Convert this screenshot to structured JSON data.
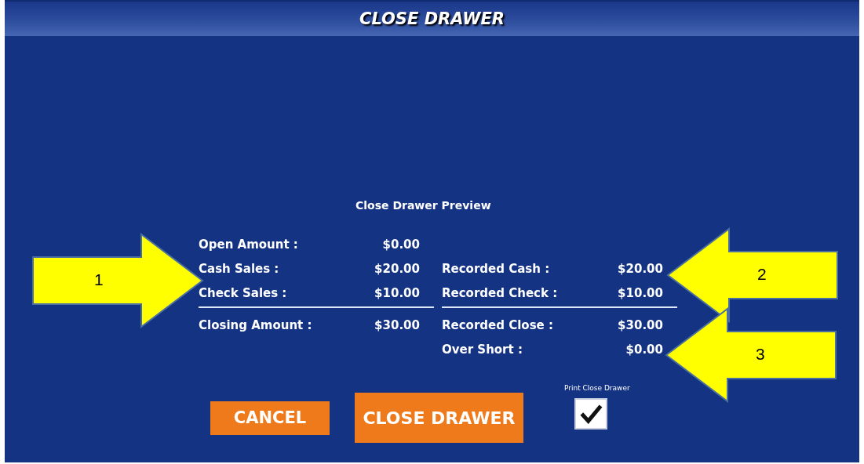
{
  "window": {
    "title": "CLOSE DRAWER"
  },
  "preview": {
    "title": "Close Drawer Preview",
    "left": {
      "rows": [
        {
          "label": "Open Amount :",
          "value": "$0.00"
        },
        {
          "label": "Cash Sales :",
          "value": "$20.00"
        },
        {
          "label": "Check Sales :",
          "value": "$10.00"
        }
      ],
      "totals": [
        {
          "label": "Closing Amount :",
          "value": "$30.00"
        }
      ]
    },
    "right": {
      "rows": [
        {
          "label": "Recorded Cash :",
          "value": "$20.00"
        },
        {
          "label": "Recorded Check :",
          "value": "$10.00"
        }
      ],
      "totals": [
        {
          "label": "Recorded Close :",
          "value": "$30.00"
        },
        {
          "label": "Over Short :",
          "value": "$0.00"
        }
      ]
    }
  },
  "buttons": [
    {
      "label": "CANCEL",
      "kind": "secondary"
    },
    {
      "label": "CLOSE DRAWER",
      "kind": "primary"
    }
  ],
  "print_option": {
    "label": "Print Close Drawer",
    "checked": true
  },
  "callouts": [
    {
      "number": "1",
      "kind": "rightward"
    },
    {
      "number": "2",
      "kind": "leftward"
    },
    {
      "number": "3",
      "kind": "leftward"
    }
  ]
}
